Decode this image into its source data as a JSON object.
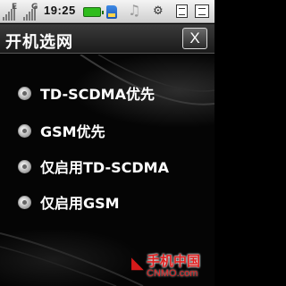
{
  "status_bar": {
    "signal1_letter": "E",
    "signal2_letter": "G",
    "time": "19:25",
    "icons": [
      "signal-icon",
      "signal-icon",
      "battery-icon",
      "memory-card-icon",
      "music-note-icon",
      "profile-mode-icon",
      "message-icon",
      "list-icon"
    ],
    "battery_color": "#2fbd1c"
  },
  "title_bar": {
    "title": "开机选网",
    "close_label": "X"
  },
  "options": [
    {
      "label": "TD-SCDMA优先"
    },
    {
      "label": "GSM优先"
    },
    {
      "label": "仅启用TD-SCDMA"
    },
    {
      "label": "仅启用GSM"
    }
  ],
  "watermark": {
    "cn": "手机中国",
    "en": "CNMO.com"
  }
}
